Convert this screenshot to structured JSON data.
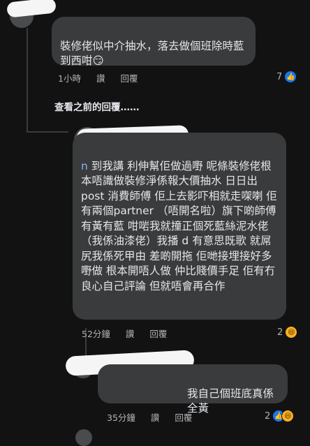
{
  "comment1": {
    "text": "裝修佬似中介抽水，落去做個班除時藍到西咁",
    "emoji": "😏",
    "time": "1小時",
    "like_label": "讚",
    "reply_label": "回覆",
    "reaction_count": "7",
    "reactions": [
      "like-icon"
    ]
  },
  "view_previous": "查看之前的回覆……",
  "reply1": {
    "mention": "n",
    "text": " 到我講 利伸幫佢做過嘢 呢條裝修佬根本唔識做裝修淨係報大價抽水 日日出 post 消費師傅 佢上去影吓相就走㗎喇 佢有兩個partner （唔開名啦）旗下啲師傅有黃有藍  咁啱我就撞正個死藍絲泥水佬（我係油漆佬）我播 d 有意思既歌 就屌尻我係死甲由 差啲開拖 佢哋接埋接好多嘢做 根本開唔人做 仲比賤價手足 佢有冇良心自己評論 但就唔會再合作",
    "time": "52分鐘",
    "like_label": "讚",
    "reply_label": "回覆",
    "reaction_count": "2",
    "reactions": [
      "haha-icon"
    ]
  },
  "reply2": {
    "text": "我自己個班底真係全黃",
    "time": "35分鐘",
    "like_label": "讚",
    "reply_label": "回覆",
    "reaction_count": "2",
    "reactions": [
      "like-icon",
      "haha-icon"
    ]
  },
  "colors": {
    "background": "#121212",
    "bubble": "#3a3b3c",
    "meta_text": "#b0b3b8",
    "like_blue": "#1877f2",
    "haha_yellow": "#f7b125"
  }
}
